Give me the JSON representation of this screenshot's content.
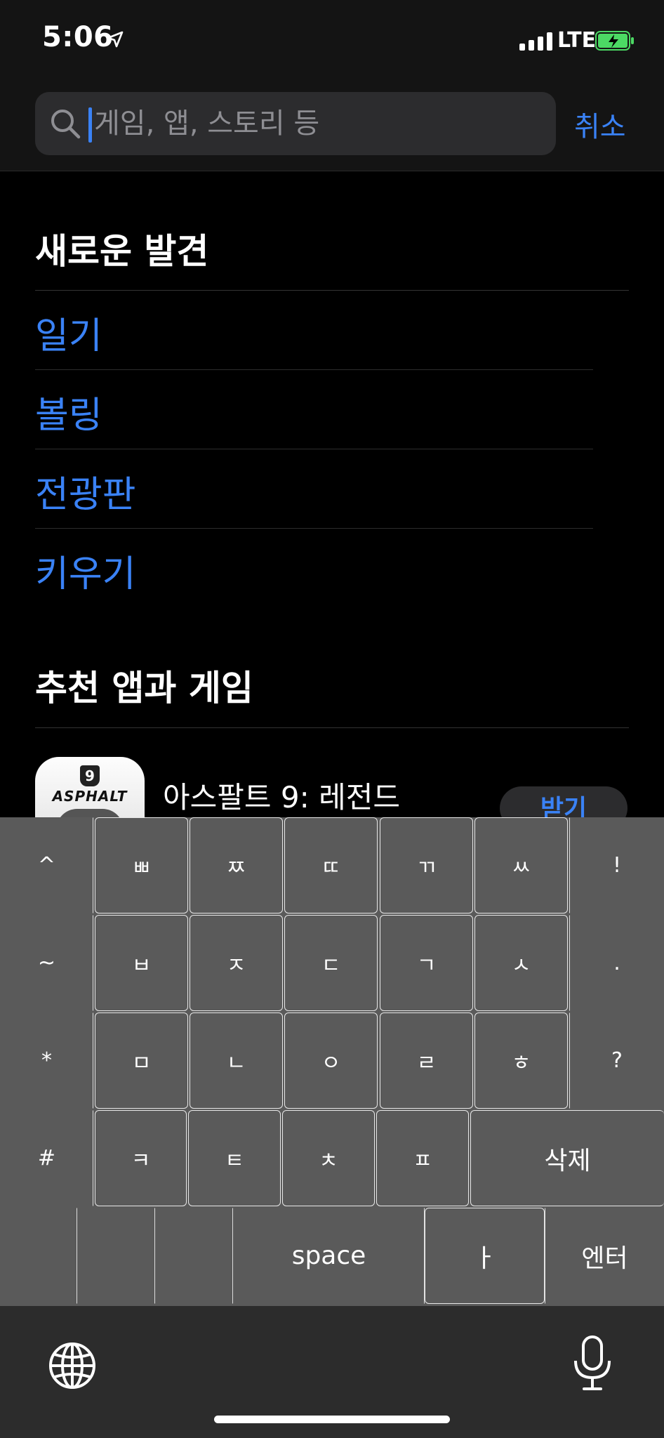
{
  "status_bar": {
    "time": "5:06",
    "network": "LTE"
  },
  "search": {
    "placeholder": "게임, 앱, 스토리 등",
    "value": "",
    "cancel_label": "취소"
  },
  "discover": {
    "title": "새로운 발견",
    "items": [
      "일기",
      "볼링",
      "전광판",
      "키우기"
    ]
  },
  "recommended": {
    "title": "추천 앱과 게임",
    "app": {
      "name": "아스팔트 9: 레전드",
      "icon_badge": "9",
      "icon_brand": "ASPHALT",
      "get_label": "받기"
    }
  },
  "keyboard": {
    "row1": [
      "^",
      "ㅃ",
      "ㅉ",
      "ㄸ",
      "ㄲ",
      "ㅆ",
      "!"
    ],
    "row2": [
      "~",
      "ㅂ",
      "ㅈ",
      "ㄷ",
      "ㄱ",
      "ㅅ",
      "."
    ],
    "row3": [
      "*",
      "ㅁ",
      "ㄴ",
      "ㅇ",
      "ㄹ",
      "ㅎ",
      "?"
    ],
    "row4": [
      "#",
      "ㅋ",
      "ㅌ",
      "ㅊ",
      "ㅍ",
      "삭제"
    ],
    "row5": [
      "",
      "",
      "",
      "space",
      "ㅏ",
      "엔터"
    ]
  },
  "colors": {
    "accent": "#3a82f6",
    "key_bg": "#5a5a5a",
    "battery": "#4cd964"
  },
  "icons": [
    "location-arrow-icon",
    "search-icon",
    "globe-icon",
    "mic-icon",
    "battery-charging-icon"
  ]
}
